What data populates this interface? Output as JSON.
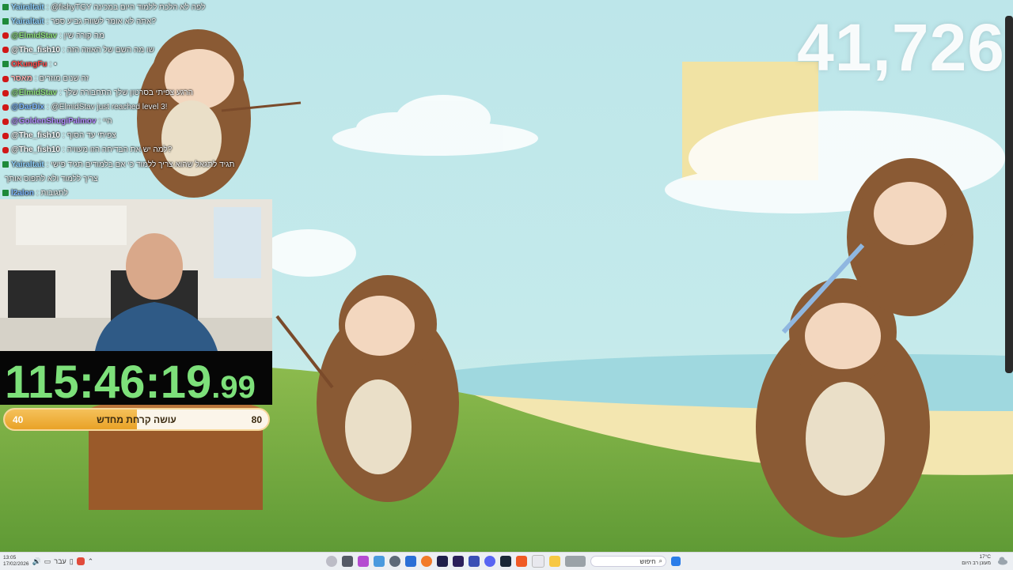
{
  "counter": "41,726",
  "chat": [
    {
      "badge": "mod",
      "user": "Yairaltait",
      "user_color": "#8fd1ff",
      "message": ": @fishyTGY לפה לא הלכת ללמוד היום במכינה"
    },
    {
      "badge": "mod",
      "user": "Yairaltait",
      "user_color": "#8fd1ff",
      "message": ": אתה לא אומר לשוות גביע ספר?"
    },
    {
      "badge": "yt",
      "user": "@ElmidStav",
      "user_color": "#8ee07a",
      "message": ": מה קורה שין"
    },
    {
      "badge": "yt",
      "user": "@The_fish10",
      "user_color": "#ffffff",
      "message": ": שו מה השם של האוזה הזה"
    },
    {
      "badge": "mod",
      "user": "OKungFu",
      "user_color": "#ff4a4a",
      "message": ": ▪"
    },
    {
      "badge": "yt",
      "user": "מאסר",
      "user_color": "#ffb0b0",
      "message": ": זה שנים מוזרים"
    },
    {
      "badge": "yt",
      "user": "@ElmidStav",
      "user_color": "#8ee07a",
      "message": ": הרגע צפיתי בסרטון שלך התחבורה שלך"
    },
    {
      "badge": "yt",
      "user": "@DarDix",
      "user_color": "#7fb8ff",
      "message": ": @ElmidStav just reached level 3!"
    },
    {
      "badge": "yt",
      "user": "@GoldenShugiPalmov",
      "user_color": "#b48cff",
      "message": ": היי"
    },
    {
      "badge": "yt",
      "user": "@The_fish10",
      "user_color": "#ffffff",
      "message": ": צפיתי עד הסוף"
    },
    {
      "badge": "yt",
      "user": "@The_fish10",
      "user_color": "#ffffff",
      "message": ": למה יש את הבדיחה הזו מעוויה?"
    },
    {
      "badge": "mod",
      "user": "Yairaltait",
      "user_color": "#8fd1ff",
      "message": ": תגיד לתגאל שהוא צריך ללמוד כי אם בלמודים תגיד פישי"
    },
    {
      "badge": "none",
      "user": "",
      "user_color": "#ffffff",
      "message": "צריך ללמוד ולא לתפוס אותך"
    },
    {
      "badge": "mod",
      "user": "l2alon",
      "user_color": "#7fb8ff",
      "message": ": לתגובות"
    }
  ],
  "timer": {
    "main": "115:46:19",
    "ms": ".99"
  },
  "progress": {
    "left": "40",
    "label": "עושה קרחת מחדש",
    "right": "80",
    "fraction": 0.5
  },
  "taskbar": {
    "time": "13:05",
    "date": "17/02/2026",
    "lang": "עבר",
    "search_label": "חיפוש",
    "weather_temp": "17°C",
    "weather_desc": "מעונן רב היום"
  },
  "colors": {
    "timer_green": "#7de07a",
    "progress_fill": "#f0b13c",
    "sky": "#bfe6ea"
  }
}
